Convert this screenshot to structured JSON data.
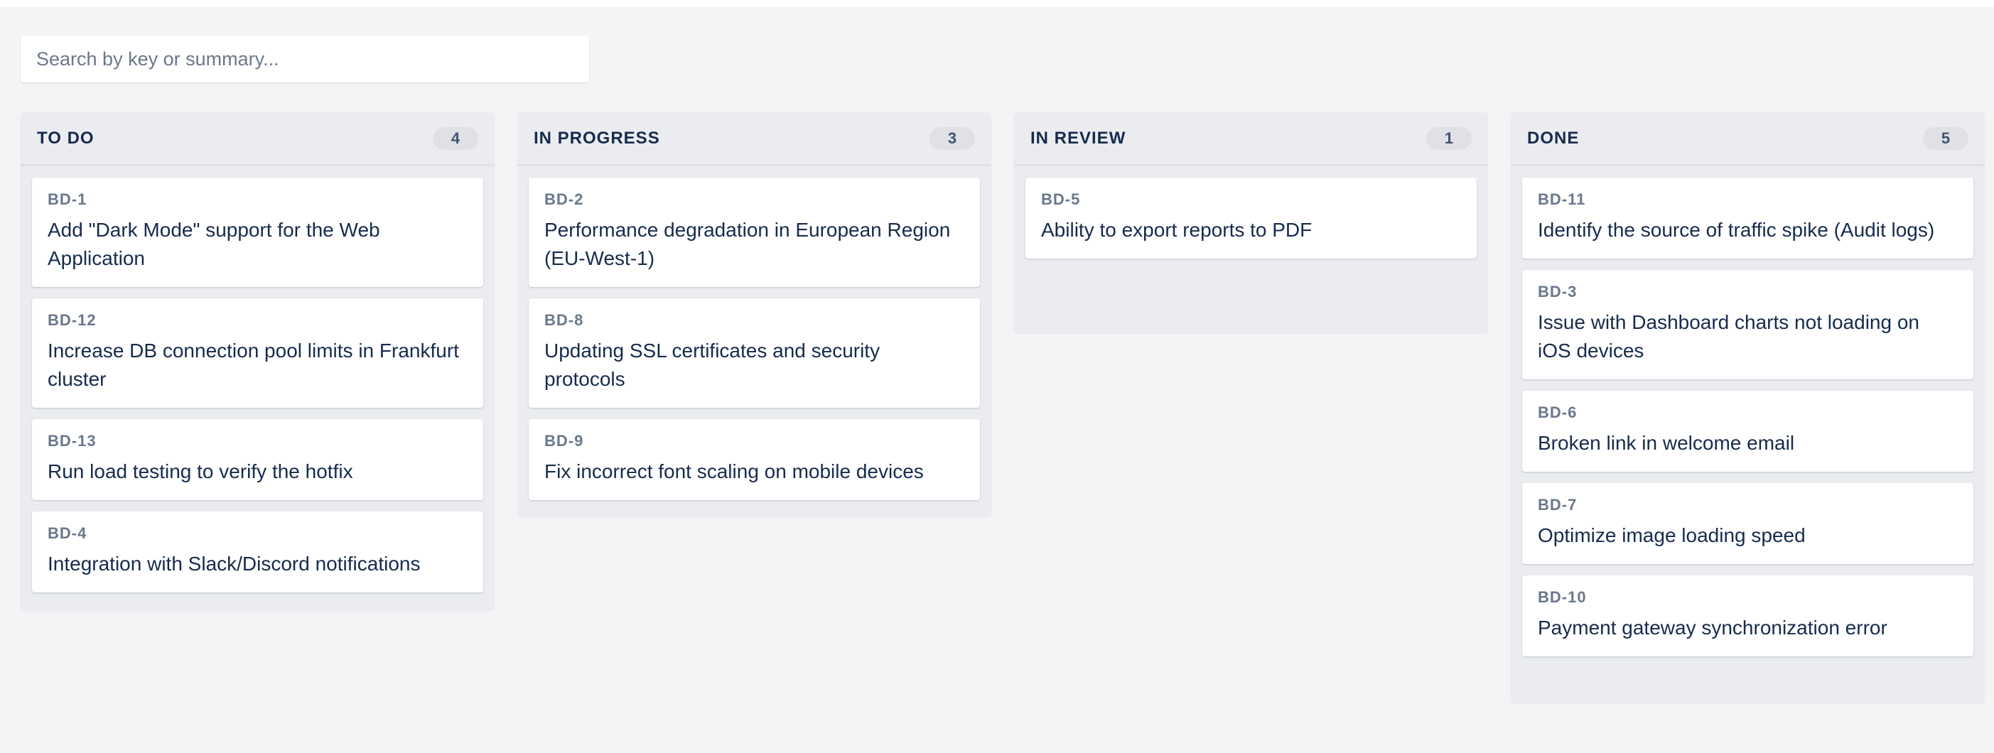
{
  "search": {
    "placeholder": "Search by key or summary..."
  },
  "columns": [
    {
      "title": "TO DO",
      "count": "4",
      "cards": [
        {
          "key": "BD-1",
          "summary": "Add \"Dark Mode\" support for the Web Application"
        },
        {
          "key": "BD-12",
          "summary": "Increase DB connection pool limits in Frankfurt cluster"
        },
        {
          "key": "BD-13",
          "summary": "Run load testing to verify the hotfix"
        },
        {
          "key": "BD-4",
          "summary": "Integration with Slack/Discord notifications"
        }
      ]
    },
    {
      "title": "IN PROGRESS",
      "count": "3",
      "cards": [
        {
          "key": "BD-2",
          "summary": "Performance degradation in European Region (EU-West-1)"
        },
        {
          "key": "BD-8",
          "summary": "Updating SSL certificates and security protocols"
        },
        {
          "key": "BD-9",
          "summary": "Fix incorrect font scaling on mobile devices"
        }
      ]
    },
    {
      "title": "IN REVIEW",
      "count": "1",
      "cards": [
        {
          "key": "BD-5",
          "summary": "Ability to export reports to PDF"
        }
      ]
    },
    {
      "title": "DONE",
      "count": "5",
      "cards": [
        {
          "key": "BD-11",
          "summary": "Identify the source of traffic spike (Audit logs)"
        },
        {
          "key": "BD-3",
          "summary": "Issue with Dashboard charts not loading on iOS devices"
        },
        {
          "key": "BD-6",
          "summary": "Broken link in welcome email"
        },
        {
          "key": "BD-7",
          "summary": "Optimize image loading speed"
        },
        {
          "key": "BD-10",
          "summary": "Payment gateway synchronization error"
        }
      ]
    }
  ],
  "colors": {
    "page_background": "#f3f4f6",
    "column_background": "#ebecf0",
    "card_background": "#ffffff",
    "text_primary": "#172b4d",
    "text_key": "#6b778c",
    "count_badge": "#dfe1e6"
  }
}
